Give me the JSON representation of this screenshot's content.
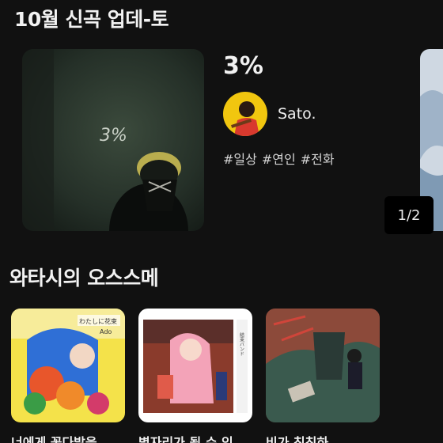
{
  "sections": {
    "new_releases_title": "10월 신곡 업데-토",
    "recommend_title": "와타시의 오스스메"
  },
  "feature": {
    "title": "3%",
    "cover_text": "3%",
    "artist": "Sato.",
    "tags": [
      "#일상",
      "#연인",
      "#전화"
    ],
    "pager": "1/2"
  },
  "recommendations": [
    {
      "label": "너에게 꽃다발을",
      "cover_text": "わたしに花束",
      "cover_artist": "Ado"
    },
    {
      "label": "별자리가 될 수 있",
      "cover_text": "結束バンド"
    },
    {
      "label": "비가 칙칙하"
    }
  ],
  "colors": {
    "background": "#111111",
    "text": "#f2f2f2",
    "pager_bg": "#000000"
  }
}
